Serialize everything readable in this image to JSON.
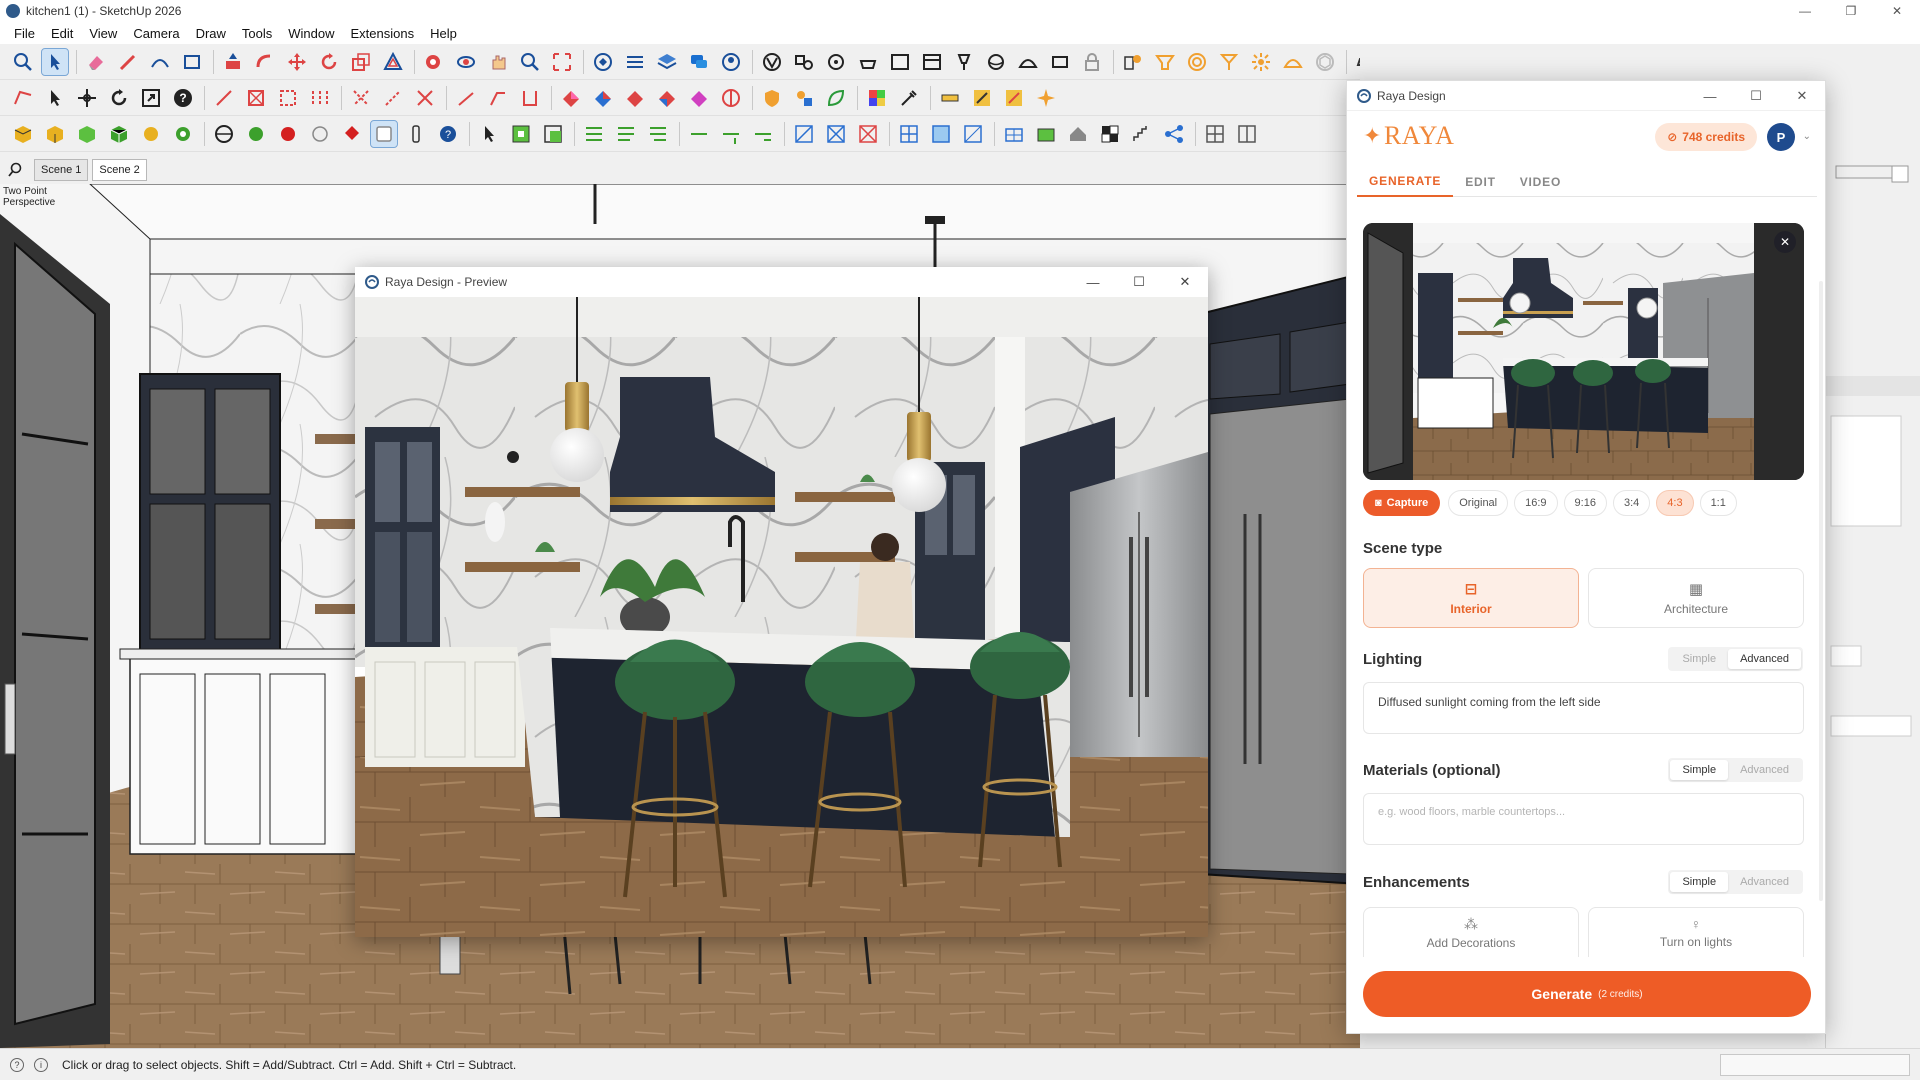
{
  "window": {
    "title": "kitchen1 (1) - SketchUp 2026",
    "controls": [
      "—",
      "❐",
      "✕"
    ]
  },
  "menu": [
    "File",
    "Edit",
    "View",
    "Camera",
    "Draw",
    "Tools",
    "Window",
    "Extensions",
    "Help"
  ],
  "scenes": {
    "tabs": [
      "Scene 1",
      "Scene 2"
    ],
    "active_index": 1
  },
  "viewport": {
    "perspective_label": "Two Point Perspective"
  },
  "preview_window": {
    "title": "Raya Design - Preview",
    "controls": [
      "—",
      "☐",
      "✕"
    ]
  },
  "raya_panel": {
    "window_title": "Raya Design",
    "controls": [
      "—",
      "☐",
      "✕"
    ],
    "brand": "RAYA",
    "credits": "748 credits",
    "avatar_initial": "P",
    "tabs": [
      "GENERATE",
      "EDIT",
      "VIDEO"
    ],
    "active_tab": "GENERATE",
    "capture_label": "Capture",
    "ratios": [
      "Original",
      "16:9",
      "9:16",
      "3:4",
      "4:3",
      "1:1"
    ],
    "active_ratio": "4:3",
    "scene_type": {
      "label": "Scene type",
      "options": [
        "Interior",
        "Architecture"
      ],
      "active": "Interior"
    },
    "lighting": {
      "label": "Lighting",
      "toggle": [
        "Simple",
        "Advanced"
      ],
      "toggle_active": "Advanced",
      "value": "Diffused sunlight coming from the left side"
    },
    "materials": {
      "label": "Materials (optional)",
      "toggle": [
        "Simple",
        "Advanced"
      ],
      "toggle_active": "Simple",
      "placeholder": "e.g. wood floors, marble countertops..."
    },
    "enhancements": {
      "label": "Enhancements",
      "toggle": [
        "Simple",
        "Advanced"
      ],
      "toggle_active": "Simple",
      "options": [
        "Add Decorations",
        "Turn on lights"
      ]
    },
    "generate": {
      "label": "Generate",
      "sub": "(2 credits)"
    }
  },
  "status": {
    "text": "Click or drag to select objects. Shift = Add/Subtract. Ctrl = Add. Shift + Ctrl = Subtract."
  },
  "colors": {
    "accent": "#ee5c26",
    "brand": "#f0883b"
  }
}
